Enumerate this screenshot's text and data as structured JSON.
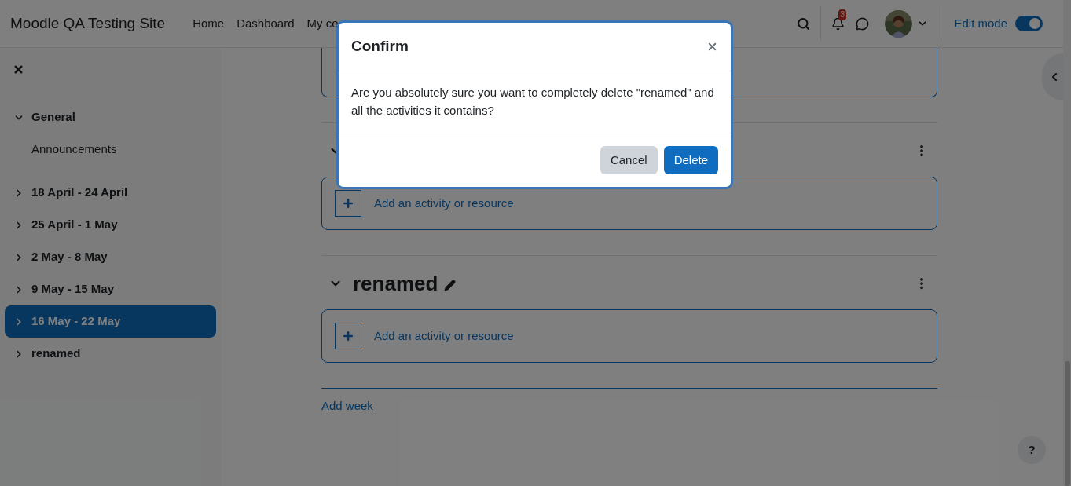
{
  "header": {
    "site_name": "Moodle QA Testing Site",
    "nav": [
      "Home",
      "Dashboard",
      "My co"
    ],
    "notification_count": "3",
    "edit_mode": {
      "label": "Edit mode",
      "on": true
    }
  },
  "sidebar": {
    "items": [
      {
        "label": "General",
        "expanded": true,
        "selected": false,
        "children": [
          {
            "label": "Announcements",
            "selected": false
          }
        ]
      },
      {
        "label": "18 April - 24 April",
        "expanded": false,
        "selected": false
      },
      {
        "label": "25 April - 1 May",
        "expanded": false,
        "selected": false
      },
      {
        "label": "2 May - 8 May",
        "expanded": false,
        "selected": false
      },
      {
        "label": "9 May - 15 May",
        "expanded": false,
        "selected": false
      },
      {
        "label": "16 May - 22 May",
        "expanded": false,
        "selected": true
      },
      {
        "label": "renamed",
        "expanded": false,
        "selected": false
      }
    ]
  },
  "sections": [
    {
      "expanded": true,
      "activity_prompt": "Add an activity or resource"
    },
    {
      "title": "renamed",
      "expanded": true,
      "activity_prompt": "Add an activity or resource"
    }
  ],
  "add_week": "Add week",
  "help_label": "?",
  "dialog": {
    "title": "Confirm",
    "message": "Are you absolutely sure you want to completely delete \"renamed\" and all the activities it contains?",
    "buttons": [
      {
        "label": "Cancel",
        "kind": "secondary"
      },
      {
        "label": "Delete",
        "kind": "primary"
      }
    ]
  }
}
